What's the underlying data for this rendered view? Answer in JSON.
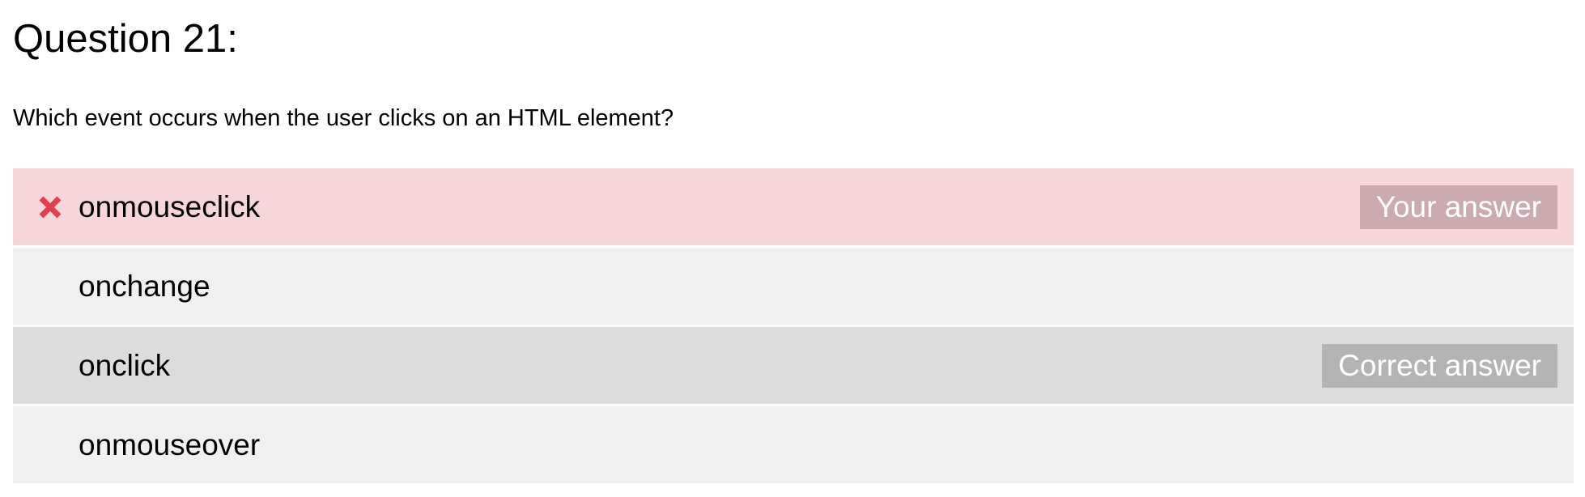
{
  "question": {
    "title": "Question 21:",
    "text": "Which event occurs when the user clicks on an HTML element?"
  },
  "options": [
    {
      "label": "onmouseclick",
      "state": "wrong",
      "badge": "Your answer",
      "icon": "x-icon"
    },
    {
      "label": "onchange",
      "state": "normal"
    },
    {
      "label": "onclick",
      "state": "correct",
      "badge": "Correct answer"
    },
    {
      "label": "onmouseover",
      "state": "normal"
    }
  ],
  "colors": {
    "wrong_bg": "#f7d6db",
    "wrong_mark": "#e0404f",
    "correct_bg": "#dcdcdc",
    "normal_bg": "#f0f0f0",
    "your_answer_badge": "#cbaab0",
    "correct_answer_badge": "#b4b4b4"
  }
}
